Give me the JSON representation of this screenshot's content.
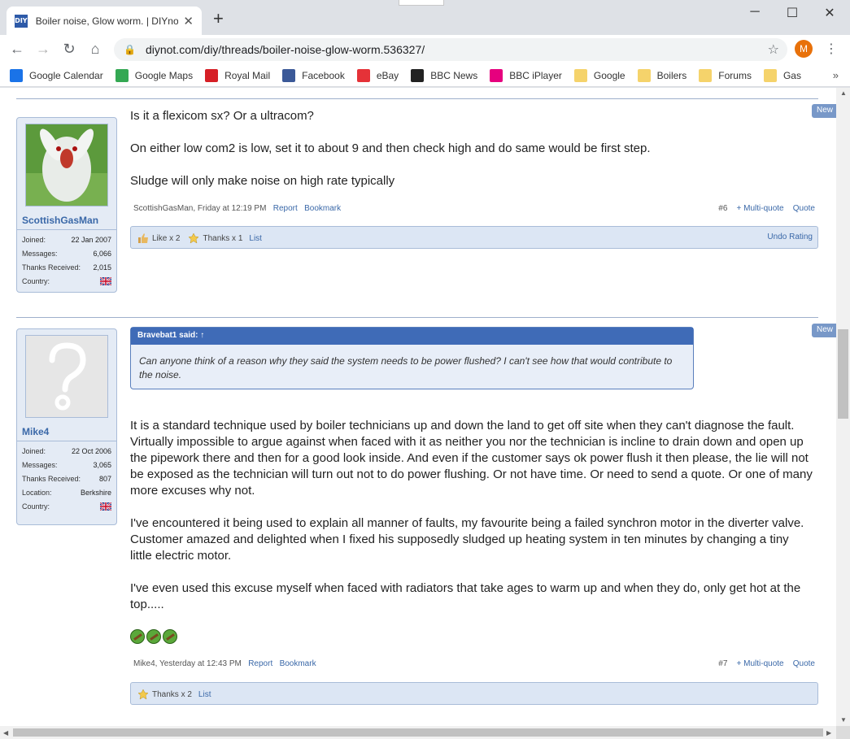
{
  "browser": {
    "tab_favicon": "DIY",
    "tab_title": "Boiler noise, Glow worm. | DIYnot",
    "tab_close": "✕",
    "new_tab": "+",
    "minimize": "─",
    "maximize": "☐",
    "close": "✕",
    "url": "diynot.com/diy/threads/boiler-noise-glow-worm.536327/",
    "profile_initial": "M",
    "bookmarks": [
      {
        "label": "Google Calendar",
        "icon": "calendar-icon",
        "color": "#1a73e8"
      },
      {
        "label": "Google Maps",
        "icon": "maps-icon",
        "color": "#34a853"
      },
      {
        "label": "Royal Mail",
        "icon": "royal-mail-icon",
        "color": "#d61f26"
      },
      {
        "label": "Facebook",
        "icon": "facebook-icon",
        "color": "#3b5998"
      },
      {
        "label": "eBay",
        "icon": "ebay-icon",
        "color": "#e53238"
      },
      {
        "label": "BBC News",
        "icon": "bbc-icon",
        "color": "#222222"
      },
      {
        "label": "BBC iPlayer",
        "icon": "iplayer-icon",
        "color": "#e6007e"
      },
      {
        "label": "Google",
        "icon": "folder-icon",
        "color": "#f5d36b"
      },
      {
        "label": "Boilers",
        "icon": "folder-icon",
        "color": "#f5d36b"
      },
      {
        "label": "Forums",
        "icon": "folder-icon",
        "color": "#f5d36b"
      },
      {
        "label": "Gas",
        "icon": "folder-icon",
        "color": "#f5d36b"
      }
    ],
    "bookmarks_more": "»"
  },
  "posts": [
    {
      "username": "ScottishGasMan",
      "stats": [
        {
          "key": "Joined:",
          "value": "22 Jan 2007"
        },
        {
          "key": "Messages:",
          "value": "6,066"
        },
        {
          "key": "Thanks Received:",
          "value": "2,015"
        },
        {
          "key": "Country:",
          "value": ""
        }
      ],
      "new_tag": "New",
      "paragraphs": [
        "Is it a flexicom sx? Or a ultracom?",
        "On either low com2 is low, set it to about 9 and then check high and do same would be first step.",
        "Sludge will only make noise on high rate typically"
      ],
      "author_time": "ScottishGasMan, Friday at 12:19 PM",
      "report": "Report",
      "bookmark": "Bookmark",
      "post_num": "#6",
      "multiquote": "+ Multi-quote",
      "quote": "Quote",
      "like_text": "Like x 2",
      "thanks_text": "Thanks x 1",
      "list": "List",
      "undo": "Undo Rating"
    },
    {
      "username": "Mike4",
      "stats": [
        {
          "key": "Joined:",
          "value": "22 Oct 2006"
        },
        {
          "key": "Messages:",
          "value": "3,065"
        },
        {
          "key": "Thanks Received:",
          "value": "807"
        },
        {
          "key": "Location:",
          "value": "Berkshire"
        },
        {
          "key": "Country:",
          "value": ""
        }
      ],
      "new_tag": "New",
      "quote_head": "Bravebat1 said: ↑",
      "quote_body": "Can anyone think of a reason why they said the system needs to be power flushed? I can't see how that would contribute to the noise.",
      "paragraphs": [
        "It is a standard technique used by boiler technicians up and down the land to get off site when they can't diagnose the fault. Virtually impossible to argue against when faced with it as neither you nor the technician is incline to drain down and open up the pipework there and then for a good look inside. And even if the customer says ok power flush it then please, the lie will not be exposed as the technician will turn out not to do power flushing. Or not have time. Or need to send a quote. Or one of many more excuses why not.",
        "I've encountered it being used to explain all manner of faults, my favourite being a failed synchron motor in the diverter valve. Customer amazed and delighted when I fixed his supposedly sludged up heating system in ten minutes by changing a tiny little electric motor.",
        "I've even used this excuse myself when faced with radiators that take ages to warm up and when they do, only get hot at the top....."
      ],
      "author_time": "Mike4, Yesterday at 12:43 PM",
      "report": "Report",
      "bookmark": "Bookmark",
      "post_num": "#7",
      "multiquote": "+ Multi-quote",
      "quote": "Quote",
      "thanks_text": "Thanks x 2",
      "list": "List"
    }
  ]
}
